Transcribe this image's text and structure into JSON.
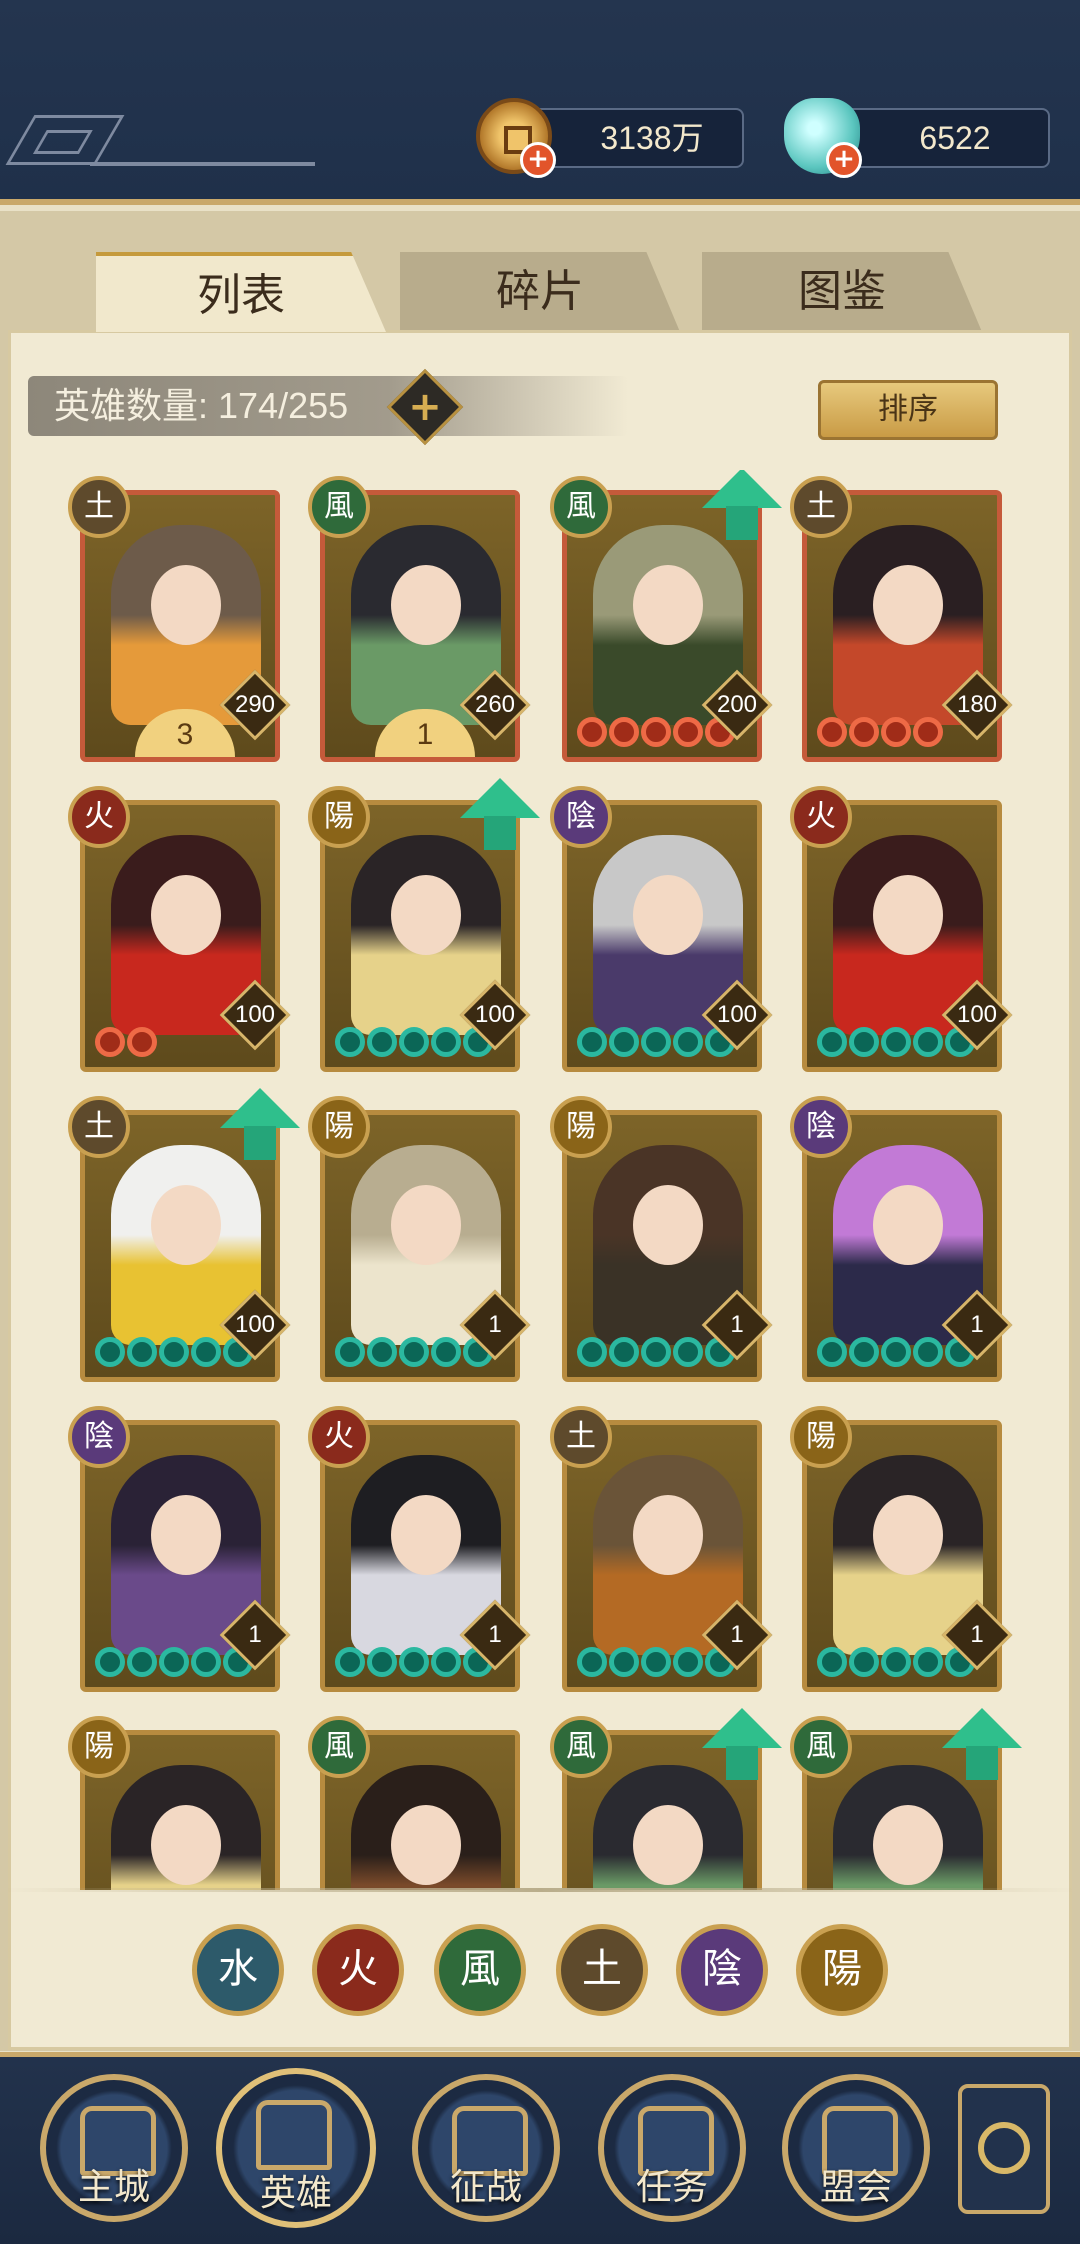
{
  "resources": {
    "coins": "3138万",
    "gems": "6522",
    "coin_icon": "copper-coin-icon",
    "gem_icon": "jade-shell-icon"
  },
  "tabs": [
    {
      "label": "列表",
      "active": true
    },
    {
      "label": "碎片",
      "active": false
    },
    {
      "label": "图鉴",
      "active": false
    }
  ],
  "hero_count": "英雄数量: 174/255",
  "sort_label": "排序",
  "elements": {
    "water": {
      "glyph": "水",
      "color": "#2d5a6a"
    },
    "fire": {
      "glyph": "火",
      "color": "#8a2a1c"
    },
    "wind": {
      "glyph": "風",
      "color": "#2f6a3a"
    },
    "earth": {
      "glyph": "土",
      "color": "#5e4a2c"
    },
    "yin": {
      "glyph": "陰",
      "color": "#5a3a7a"
    },
    "yang": {
      "glyph": "陽",
      "color": "#8a6418"
    }
  },
  "heroes": [
    {
      "element": "earth",
      "level": "290",
      "rank": "3",
      "stars": 0,
      "star_color": "teal",
      "upgrade": false,
      "red": true,
      "hair": "#6d5b4a",
      "robe": "#e59a3a"
    },
    {
      "element": "wind",
      "level": "260",
      "rank": "1",
      "stars": 0,
      "star_color": "teal",
      "upgrade": false,
      "red": true,
      "hair": "#2a2a30",
      "robe": "#6a9a66"
    },
    {
      "element": "wind",
      "level": "200",
      "rank": "",
      "stars": 5,
      "star_color": "red",
      "upgrade": true,
      "red": true,
      "hair": "#9a9a78",
      "robe": "#3a4a2a"
    },
    {
      "element": "earth",
      "level": "180",
      "rank": "",
      "stars": 4,
      "star_color": "red",
      "upgrade": false,
      "red": true,
      "hair": "#2a1f22",
      "robe": "#c4482a"
    },
    {
      "element": "fire",
      "level": "100",
      "rank": "",
      "stars": 2,
      "star_color": "red",
      "upgrade": false,
      "red": false,
      "hair": "#3a1c1c",
      "robe": "#c8281e"
    },
    {
      "element": "yang",
      "level": "100",
      "rank": "",
      "stars": 5,
      "star_color": "teal",
      "upgrade": true,
      "red": false,
      "hair": "#2a2426",
      "robe": "#e6d28a"
    },
    {
      "element": "yin",
      "level": "100",
      "rank": "",
      "stars": 5,
      "star_color": "teal",
      "upgrade": false,
      "red": false,
      "hair": "#c8c8c8",
      "robe": "#4a3a6a"
    },
    {
      "element": "fire",
      "level": "100",
      "rank": "",
      "stars": 5,
      "star_color": "teal",
      "upgrade": false,
      "red": false,
      "hair": "#3a1c1c",
      "robe": "#c8281e"
    },
    {
      "element": "earth",
      "level": "100",
      "rank": "",
      "stars": 5,
      "star_color": "teal",
      "upgrade": true,
      "red": false,
      "hair": "#f0f0ee",
      "robe": "#e8c232"
    },
    {
      "element": "yang",
      "level": "1",
      "rank": "",
      "stars": 5,
      "star_color": "teal",
      "upgrade": false,
      "red": false,
      "hair": "#b8ad90",
      "robe": "#ece4cc"
    },
    {
      "element": "yang",
      "level": "1",
      "rank": "",
      "stars": 5,
      "star_color": "teal",
      "upgrade": false,
      "red": false,
      "hair": "#4a3426",
      "robe": "#3a3226"
    },
    {
      "element": "yin",
      "level": "1",
      "rank": "",
      "stars": 5,
      "star_color": "teal",
      "upgrade": false,
      "red": false,
      "hair": "#c27ad6",
      "robe": "#2c2a4a"
    },
    {
      "element": "yin",
      "level": "1",
      "rank": "",
      "stars": 5,
      "star_color": "teal",
      "upgrade": false,
      "red": false,
      "hair": "#2a2236",
      "robe": "#6a4a8a"
    },
    {
      "element": "fire",
      "level": "1",
      "rank": "",
      "stars": 5,
      "star_color": "teal",
      "upgrade": false,
      "red": false,
      "hair": "#1e1e22",
      "robe": "#d8d8e0"
    },
    {
      "element": "earth",
      "level": "1",
      "rank": "",
      "stars": 5,
      "star_color": "teal",
      "upgrade": false,
      "red": false,
      "hair": "#6a5438",
      "robe": "#b46a24"
    },
    {
      "element": "yang",
      "level": "1",
      "rank": "",
      "stars": 5,
      "star_color": "teal",
      "upgrade": false,
      "red": false,
      "hair": "#2a2426",
      "robe": "#e6d28a"
    },
    {
      "element": "yang",
      "level": "",
      "rank": "",
      "stars": 0,
      "star_color": "teal",
      "upgrade": false,
      "red": false,
      "hair": "#2a2426",
      "robe": "#e6d28a"
    },
    {
      "element": "wind",
      "level": "",
      "rank": "",
      "stars": 0,
      "star_color": "teal",
      "upgrade": false,
      "red": false,
      "hair": "#2a1f1a",
      "robe": "#7a4a2a"
    },
    {
      "element": "wind",
      "level": "",
      "rank": "",
      "stars": 0,
      "star_color": "teal",
      "upgrade": true,
      "red": false,
      "hair": "#2a2a30",
      "robe": "#6a9a66"
    },
    {
      "element": "wind",
      "level": "",
      "rank": "",
      "stars": 0,
      "star_color": "teal",
      "upgrade": true,
      "red": false,
      "hair": "#2a2a30",
      "robe": "#6a9a66"
    }
  ],
  "filters": [
    "water",
    "fire",
    "wind",
    "earth",
    "yin",
    "yang"
  ],
  "nav": [
    {
      "label": "主城",
      "icon": "city-gate-icon",
      "active": false
    },
    {
      "label": "英雄",
      "icon": "hero-portrait-icon",
      "active": true
    },
    {
      "label": "征战",
      "icon": "battle-helmet-icon",
      "active": false
    },
    {
      "label": "任务",
      "icon": "quest-scroll-icon",
      "active": false
    },
    {
      "label": "盟会",
      "icon": "alliance-hall-icon",
      "active": false
    }
  ],
  "menu_icon": "menu-knot-icon"
}
